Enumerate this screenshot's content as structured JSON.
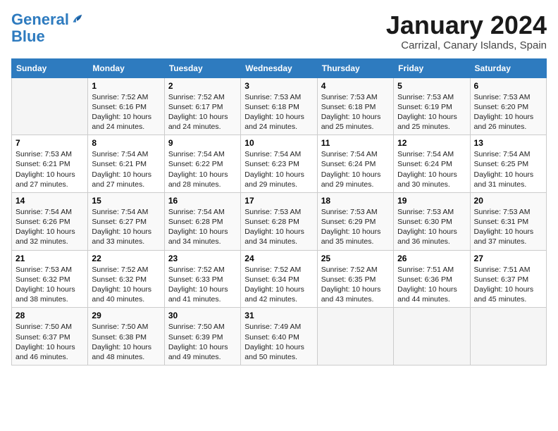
{
  "logo": {
    "line1": "General",
    "line2": "Blue"
  },
  "title": "January 2024",
  "location": "Carrizal, Canary Islands, Spain",
  "days_of_week": [
    "Sunday",
    "Monday",
    "Tuesday",
    "Wednesday",
    "Thursday",
    "Friday",
    "Saturday"
  ],
  "weeks": [
    [
      {
        "day": "",
        "sunrise": "",
        "sunset": "",
        "daylight": ""
      },
      {
        "day": "1",
        "sunrise": "Sunrise: 7:52 AM",
        "sunset": "Sunset: 6:16 PM",
        "daylight": "Daylight: 10 hours and 24 minutes."
      },
      {
        "day": "2",
        "sunrise": "Sunrise: 7:52 AM",
        "sunset": "Sunset: 6:17 PM",
        "daylight": "Daylight: 10 hours and 24 minutes."
      },
      {
        "day": "3",
        "sunrise": "Sunrise: 7:53 AM",
        "sunset": "Sunset: 6:18 PM",
        "daylight": "Daylight: 10 hours and 24 minutes."
      },
      {
        "day": "4",
        "sunrise": "Sunrise: 7:53 AM",
        "sunset": "Sunset: 6:18 PM",
        "daylight": "Daylight: 10 hours and 25 minutes."
      },
      {
        "day": "5",
        "sunrise": "Sunrise: 7:53 AM",
        "sunset": "Sunset: 6:19 PM",
        "daylight": "Daylight: 10 hours and 25 minutes."
      },
      {
        "day": "6",
        "sunrise": "Sunrise: 7:53 AM",
        "sunset": "Sunset: 6:20 PM",
        "daylight": "Daylight: 10 hours and 26 minutes."
      }
    ],
    [
      {
        "day": "7",
        "sunrise": "Sunrise: 7:53 AM",
        "sunset": "Sunset: 6:21 PM",
        "daylight": "Daylight: 10 hours and 27 minutes."
      },
      {
        "day": "8",
        "sunrise": "Sunrise: 7:54 AM",
        "sunset": "Sunset: 6:21 PM",
        "daylight": "Daylight: 10 hours and 27 minutes."
      },
      {
        "day": "9",
        "sunrise": "Sunrise: 7:54 AM",
        "sunset": "Sunset: 6:22 PM",
        "daylight": "Daylight: 10 hours and 28 minutes."
      },
      {
        "day": "10",
        "sunrise": "Sunrise: 7:54 AM",
        "sunset": "Sunset: 6:23 PM",
        "daylight": "Daylight: 10 hours and 29 minutes."
      },
      {
        "day": "11",
        "sunrise": "Sunrise: 7:54 AM",
        "sunset": "Sunset: 6:24 PM",
        "daylight": "Daylight: 10 hours and 29 minutes."
      },
      {
        "day": "12",
        "sunrise": "Sunrise: 7:54 AM",
        "sunset": "Sunset: 6:24 PM",
        "daylight": "Daylight: 10 hours and 30 minutes."
      },
      {
        "day": "13",
        "sunrise": "Sunrise: 7:54 AM",
        "sunset": "Sunset: 6:25 PM",
        "daylight": "Daylight: 10 hours and 31 minutes."
      }
    ],
    [
      {
        "day": "14",
        "sunrise": "Sunrise: 7:54 AM",
        "sunset": "Sunset: 6:26 PM",
        "daylight": "Daylight: 10 hours and 32 minutes."
      },
      {
        "day": "15",
        "sunrise": "Sunrise: 7:54 AM",
        "sunset": "Sunset: 6:27 PM",
        "daylight": "Daylight: 10 hours and 33 minutes."
      },
      {
        "day": "16",
        "sunrise": "Sunrise: 7:54 AM",
        "sunset": "Sunset: 6:28 PM",
        "daylight": "Daylight: 10 hours and 34 minutes."
      },
      {
        "day": "17",
        "sunrise": "Sunrise: 7:53 AM",
        "sunset": "Sunset: 6:28 PM",
        "daylight": "Daylight: 10 hours and 34 minutes."
      },
      {
        "day": "18",
        "sunrise": "Sunrise: 7:53 AM",
        "sunset": "Sunset: 6:29 PM",
        "daylight": "Daylight: 10 hours and 35 minutes."
      },
      {
        "day": "19",
        "sunrise": "Sunrise: 7:53 AM",
        "sunset": "Sunset: 6:30 PM",
        "daylight": "Daylight: 10 hours and 36 minutes."
      },
      {
        "day": "20",
        "sunrise": "Sunrise: 7:53 AM",
        "sunset": "Sunset: 6:31 PM",
        "daylight": "Daylight: 10 hours and 37 minutes."
      }
    ],
    [
      {
        "day": "21",
        "sunrise": "Sunrise: 7:53 AM",
        "sunset": "Sunset: 6:32 PM",
        "daylight": "Daylight: 10 hours and 38 minutes."
      },
      {
        "day": "22",
        "sunrise": "Sunrise: 7:52 AM",
        "sunset": "Sunset: 6:32 PM",
        "daylight": "Daylight: 10 hours and 40 minutes."
      },
      {
        "day": "23",
        "sunrise": "Sunrise: 7:52 AM",
        "sunset": "Sunset: 6:33 PM",
        "daylight": "Daylight: 10 hours and 41 minutes."
      },
      {
        "day": "24",
        "sunrise": "Sunrise: 7:52 AM",
        "sunset": "Sunset: 6:34 PM",
        "daylight": "Daylight: 10 hours and 42 minutes."
      },
      {
        "day": "25",
        "sunrise": "Sunrise: 7:52 AM",
        "sunset": "Sunset: 6:35 PM",
        "daylight": "Daylight: 10 hours and 43 minutes."
      },
      {
        "day": "26",
        "sunrise": "Sunrise: 7:51 AM",
        "sunset": "Sunset: 6:36 PM",
        "daylight": "Daylight: 10 hours and 44 minutes."
      },
      {
        "day": "27",
        "sunrise": "Sunrise: 7:51 AM",
        "sunset": "Sunset: 6:37 PM",
        "daylight": "Daylight: 10 hours and 45 minutes."
      }
    ],
    [
      {
        "day": "28",
        "sunrise": "Sunrise: 7:50 AM",
        "sunset": "Sunset: 6:37 PM",
        "daylight": "Daylight: 10 hours and 46 minutes."
      },
      {
        "day": "29",
        "sunrise": "Sunrise: 7:50 AM",
        "sunset": "Sunset: 6:38 PM",
        "daylight": "Daylight: 10 hours and 48 minutes."
      },
      {
        "day": "30",
        "sunrise": "Sunrise: 7:50 AM",
        "sunset": "Sunset: 6:39 PM",
        "daylight": "Daylight: 10 hours and 49 minutes."
      },
      {
        "day": "31",
        "sunrise": "Sunrise: 7:49 AM",
        "sunset": "Sunset: 6:40 PM",
        "daylight": "Daylight: 10 hours and 50 minutes."
      },
      {
        "day": "",
        "sunrise": "",
        "sunset": "",
        "daylight": ""
      },
      {
        "day": "",
        "sunrise": "",
        "sunset": "",
        "daylight": ""
      },
      {
        "day": "",
        "sunrise": "",
        "sunset": "",
        "daylight": ""
      }
    ]
  ]
}
